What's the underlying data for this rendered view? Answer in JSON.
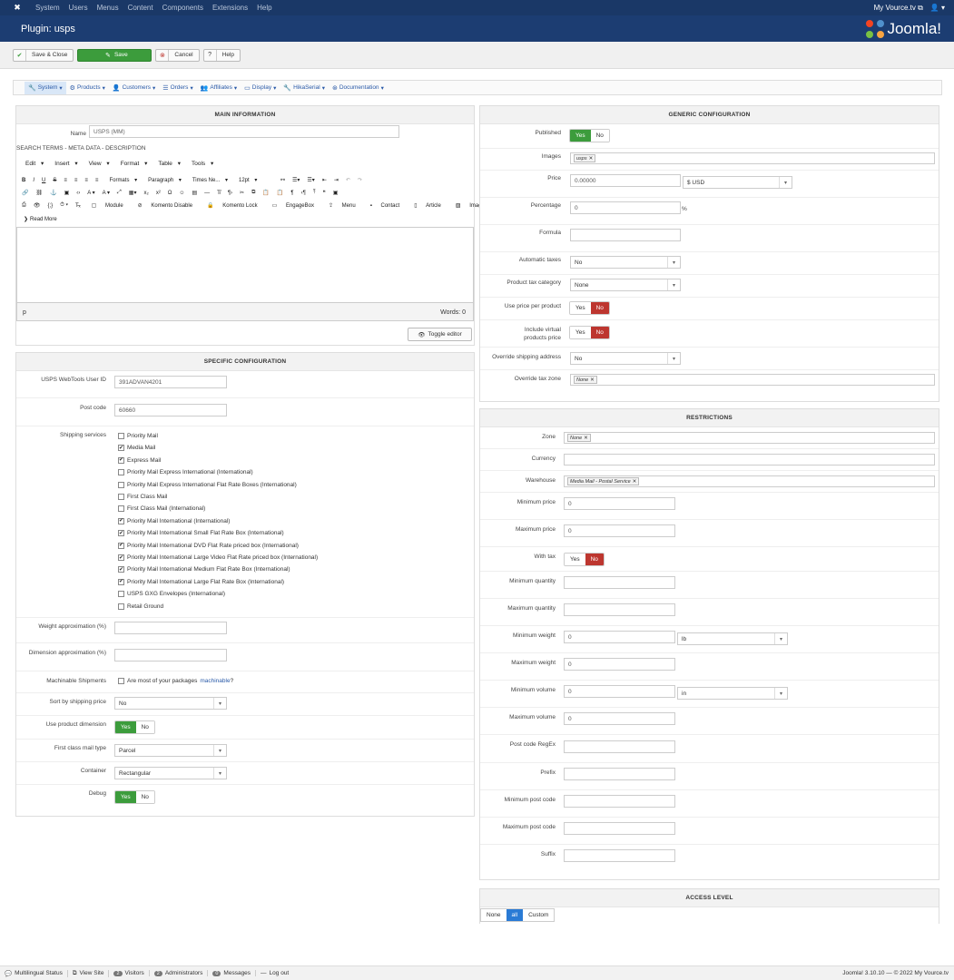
{
  "topbar": {
    "menu": [
      "System",
      "Users",
      "Menus",
      "Content",
      "Components",
      "Extensions",
      "Help"
    ],
    "site": "My Vource.tv",
    "user_icon": "user-icon"
  },
  "title": "Plugin: usps",
  "logo": "Joomla!",
  "toolbar": {
    "save_close": "Save & Close",
    "save": "Save",
    "cancel": "Cancel",
    "help": "Help"
  },
  "nav": [
    "System",
    "Products",
    "Customers",
    "Orders",
    "Affiliates",
    "Display",
    "HikaSerial",
    "Documentation"
  ],
  "main": {
    "header": "MAIN INFORMATION",
    "name_label": "Name",
    "name_value": "USPS (MM)",
    "seo_tabs": "SEARCH TERMS - META DATA - DESCRIPTION",
    "editor_menu": [
      "Edit",
      "Insert",
      "View",
      "Format",
      "Table",
      "Tools"
    ],
    "formats": "Formats",
    "paragraph": "Paragraph",
    "font": "Times Ne...",
    "size": "12pt",
    "row3": [
      "Module",
      "Komento Disable",
      "Komento Lock",
      "EngageBox",
      "Menu",
      "Contact",
      "Article",
      "Image"
    ],
    "read_more": "Read More",
    "path": "p",
    "words": "Words: 0",
    "toggle": "Toggle editor"
  },
  "specific": {
    "header": "SPECIFIC CONFIGURATION",
    "userid_label": "USPS WebTools User ID",
    "userid": "391ADVAN4201",
    "postcode_label": "Post code",
    "postcode": "60660",
    "services_label": "Shipping services",
    "services": [
      {
        "t": "Priority Mail",
        "c": false
      },
      {
        "t": "Media Mail",
        "c": true
      },
      {
        "t": "Express Mail",
        "c": true
      },
      {
        "t": "Priority Mail Express International (International)",
        "c": false
      },
      {
        "t": "Priority Mail Express International Flat Rate Boxes (International)",
        "c": false
      },
      {
        "t": "First Class Mail",
        "c": false
      },
      {
        "t": "First Class Mail (International)",
        "c": false
      },
      {
        "t": "Priority Mail International (International)",
        "c": true
      },
      {
        "t": "Priority Mail International Small Flat Rate Box (International)",
        "c": true
      },
      {
        "t": "Priority Mail International DVD Flat Rate priced box (International)",
        "c": true
      },
      {
        "t": "Priority Mail International Large Video Flat Rate priced box (International)",
        "c": true
      },
      {
        "t": "Priority Mail International Medium Flat Rate Box (International)",
        "c": true
      },
      {
        "t": "Priority Mail International Large Flat Rate Box (International)",
        "c": true
      },
      {
        "t": "USPS GXG Envelopes (International)",
        "c": false
      },
      {
        "t": "Retail Ground",
        "c": false
      }
    ],
    "weight_label": "Weight approximation (%)",
    "dim_label": "Dimension approximation (%)",
    "mach_label": "Machinable Shipments",
    "mach_text": "Are most of your packages",
    "mach_link": "machinable",
    "mach_q": "?",
    "sort_label": "Sort by shipping price",
    "sort": "No",
    "usedim_label": "Use product dimension",
    "firstclass_label": "First class mail type",
    "firstclass": "Parcel",
    "container_label": "Container",
    "container": "Rectangular",
    "debug_label": "Debug",
    "yes": "Yes",
    "no": "No"
  },
  "generic": {
    "header": "GENERIC CONFIGURATION",
    "published": "Published",
    "images": "Images",
    "images_tag": "usps",
    "price": "Price",
    "price_value": "0.00000",
    "currency": "$ USD",
    "percentage": "Percentage",
    "percentage_value": "0",
    "pct": "%",
    "formula": "Formula",
    "autotax": "Automatic taxes",
    "autotax_value": "No",
    "taxcat": "Product tax category",
    "taxcat_value": "None",
    "useprice": "Use price per product",
    "virtual": "Include virtual products price",
    "override_ship": "Override shipping address",
    "override_ship_value": "No",
    "override_tax": "Override tax zone",
    "override_tax_tag": "None",
    "yes": "Yes",
    "no": "No"
  },
  "restrictions": {
    "header": "RESTRICTIONS",
    "zone": "Zone",
    "zone_tag": "None",
    "currency": "Currency",
    "warehouse": "Warehouse",
    "warehouse_tag": "Media Mail - Postal Service",
    "min_price": "Minimum price",
    "min_price_v": "0",
    "max_price": "Maximum price",
    "max_price_v": "0",
    "with_tax": "With tax",
    "min_qty": "Minimum quantity",
    "max_qty": "Maximum quantity",
    "min_weight": "Minimum weight",
    "min_weight_v": "0",
    "weight_unit": "lb",
    "max_weight": "Maximum weight",
    "max_weight_v": "0",
    "min_vol": "Minimum volume",
    "min_vol_v": "0",
    "vol_unit": "in",
    "max_vol": "Maximum volume",
    "max_vol_v": "0",
    "postcode_re": "Post code RegEx",
    "prefix": "Prefix",
    "min_pc": "Minimum post code",
    "max_pc": "Maximum post code",
    "suffix": "Suffix",
    "yes": "Yes",
    "no": "No"
  },
  "access": {
    "header": "ACCESS LEVEL",
    "none": "None",
    "all": "all",
    "custom": "Custom"
  },
  "footer": {
    "multilingual": "Multilingual Status",
    "view_site": "View Site",
    "visitors_n": "2",
    "visitors": "Visitors",
    "admins_n": "2",
    "admins": "Administrators",
    "messages_n": "0",
    "messages": "Messages",
    "logout": "Log out",
    "copyright": "Joomla! 3.10.10 — © 2022 My Vource.tv"
  },
  "colors": {
    "topbar": "#1a3867",
    "titlebar": "#1c3d72",
    "green": "#3c9c3c",
    "red": "#bd362f",
    "blue": "#2a7bd5"
  }
}
